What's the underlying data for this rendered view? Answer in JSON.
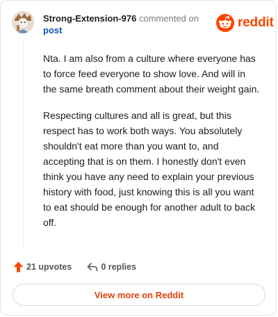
{
  "comment": {
    "username": "Strong-Extension-976",
    "commented_on": "commented on",
    "post_link": "post",
    "paragraphs": [
      "Nta. I am also from a culture where everyone has to force feed everyone to show love. And will in the same breath comment about their weight gain.",
      "Respecting cultures and all is great, but this respect has to work both ways. You absolutely shouldn't eat more than you want to, and accepting that is on them. I honestly don't even think you have any need to explain your previous history with food, just knowing this is all you want to eat should be enough for another adult to back off."
    ]
  },
  "brand": {
    "name": "reddit",
    "icon": "reddit-logo-icon",
    "color": "#ff4500"
  },
  "actions": {
    "upvotes": "21 upvotes",
    "replies": "0 replies"
  },
  "cta": {
    "label": "View more on Reddit"
  },
  "colors": {
    "accent": "#ff4500",
    "link": "#0b57b5"
  }
}
